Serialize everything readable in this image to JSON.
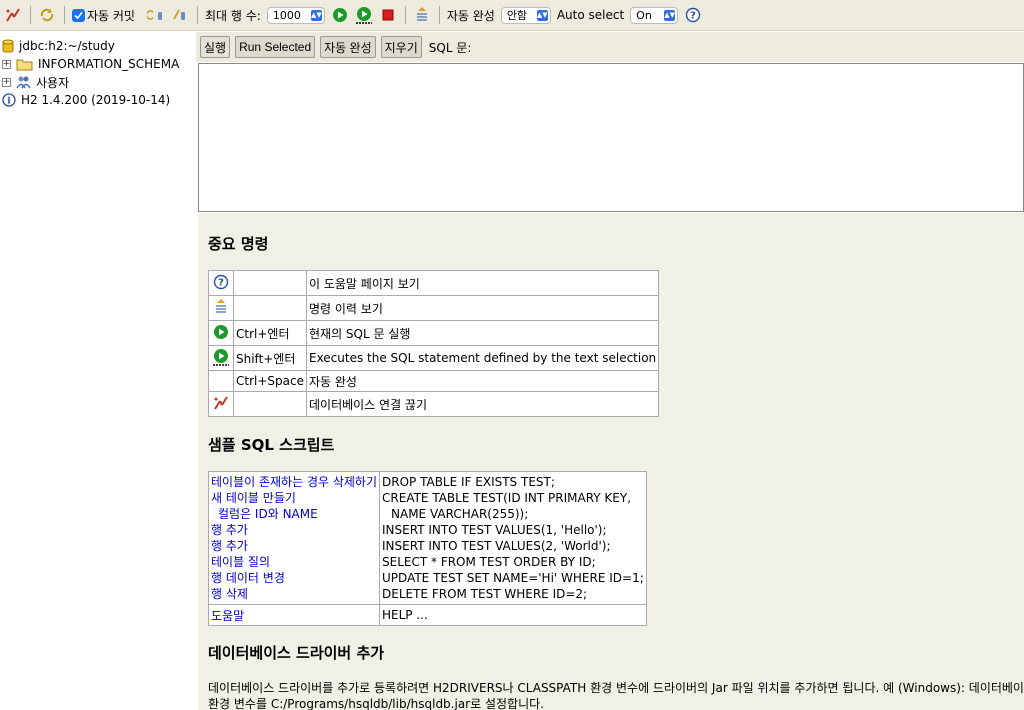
{
  "toolbar": {
    "auto_commit_label": "자동 커밋",
    "max_rows_label": "최대 행 수:",
    "max_rows_value": "1000",
    "autocomplete_label": "자동 완성",
    "autocomplete_value": "안함",
    "auto_select_label": "Auto select",
    "auto_select_value": "On"
  },
  "tree": {
    "connection": "jdbc:h2:~/study",
    "schema": "INFORMATION_SCHEMA",
    "users": "사용자",
    "version": "H2 1.4.200 (2019-10-14)"
  },
  "query": {
    "run_label": "실행",
    "run_selected_label": "Run Selected",
    "autocomplete_label": "자동 완성",
    "clear_label": "지우기",
    "sql_label": "SQL 문:"
  },
  "help": {
    "important_title": "중요 명령",
    "commands": [
      {
        "icon": "help-icon",
        "key": "",
        "desc": "이 도움말 페이지 보기"
      },
      {
        "icon": "history-icon",
        "key": "",
        "desc": "명령 이력 보기"
      },
      {
        "icon": "run-icon",
        "key": "Ctrl+엔터",
        "desc": "현재의 SQL 문 실행"
      },
      {
        "icon": "run-selected-icon",
        "key": "Shift+엔터",
        "desc": "Executes the SQL statement defined by the text selection"
      },
      {
        "icon": "",
        "key": "Ctrl+Space",
        "desc": "자동 완성"
      },
      {
        "icon": "disconnect-icon",
        "key": "",
        "desc": "데이터베이스 연결 끊기"
      }
    ],
    "sample_title": "샘플 SQL 스크립트",
    "samples": [
      {
        "label": "테이블이 존재하는 경우 삭제하기",
        "code": "DROP TABLE IF EXISTS TEST;"
      },
      {
        "label": "새 테이블 만들기",
        "code": "CREATE TABLE TEST(ID INT PRIMARY KEY,"
      },
      {
        "label": "  컬럼은 ID와 NAME",
        "code": "   NAME VARCHAR(255));"
      },
      {
        "label": "행 추가",
        "code": "INSERT INTO TEST VALUES(1, 'Hello');"
      },
      {
        "label": "행 추가",
        "code": "INSERT INTO TEST VALUES(2, 'World');"
      },
      {
        "label": "테이블 질의",
        "code": "SELECT * FROM TEST ORDER BY ID;"
      },
      {
        "label": "행 데이터 변경",
        "code": "UPDATE TEST SET NAME='Hi' WHERE ID=1;"
      },
      {
        "label": "행 삭제",
        "code": "DELETE FROM TEST WHERE ID=2;"
      }
    ],
    "help_label": "도움말",
    "help_code": "HELP ...",
    "driver_title": "데이터베이스 드라이버 추가",
    "driver_line1": "데이터베이스 드라이버를 추가로 등록하려면 H2DRIVERS나 CLASSPATH 환경 변수에 드라이버의 Jar 파일 위치를 추가하면 됩니다. 예 (Windows): 데이터베이스 드라이버",
    "driver_line2": "환경 변수를 C:/Programs/hsqldb/lib/hsqldb.jar로 설정합니다."
  },
  "colors": {
    "toolbar_bg": "#ecebde",
    "help_bg": "#f0f0e6",
    "link": "#0000cc",
    "run_green": "#1c9a2a",
    "stop_red": "#d42020"
  }
}
